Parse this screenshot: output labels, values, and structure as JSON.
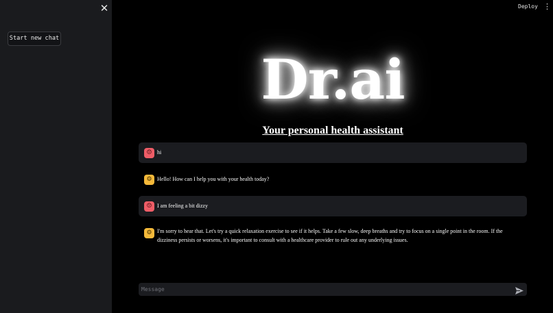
{
  "sidebar": {
    "close_icon": "close-icon",
    "new_chat_label": "Start new chat"
  },
  "header": {
    "deploy_label": "Deploy",
    "menu_icon": "vertical-dots-icon"
  },
  "hero": {
    "title": "Dr.ai",
    "subtitle": "Your personal health assistant"
  },
  "messages": [
    {
      "role": "user",
      "avatar_icon": "user-face-icon",
      "text": "hi"
    },
    {
      "role": "assistant",
      "avatar_icon": "robot-icon",
      "text": "Hello! How can I help you with your health today?"
    },
    {
      "role": "user",
      "avatar_icon": "user-face-icon",
      "text": "I am feeling a bit dizzy"
    },
    {
      "role": "assistant",
      "avatar_icon": "robot-icon",
      "text": "I'm sorry to hear that. Let's try a quick relaxation exercise to see if it helps. Take a few slow, deep breaths and try to focus on a single point in the room. If the dizziness persists or worsens, it's important to consult with a healthcare provider to rule out any underlying issues."
    }
  ],
  "chat_input": {
    "placeholder": "Message",
    "value": "",
    "send_icon": "send-icon"
  },
  "colors": {
    "background": "#000000",
    "sidebar": "#1a1b1e",
    "user_bubble": "#1b1c20",
    "user_avatar": "#ee5d67",
    "assistant_avatar": "#f5b93a"
  }
}
